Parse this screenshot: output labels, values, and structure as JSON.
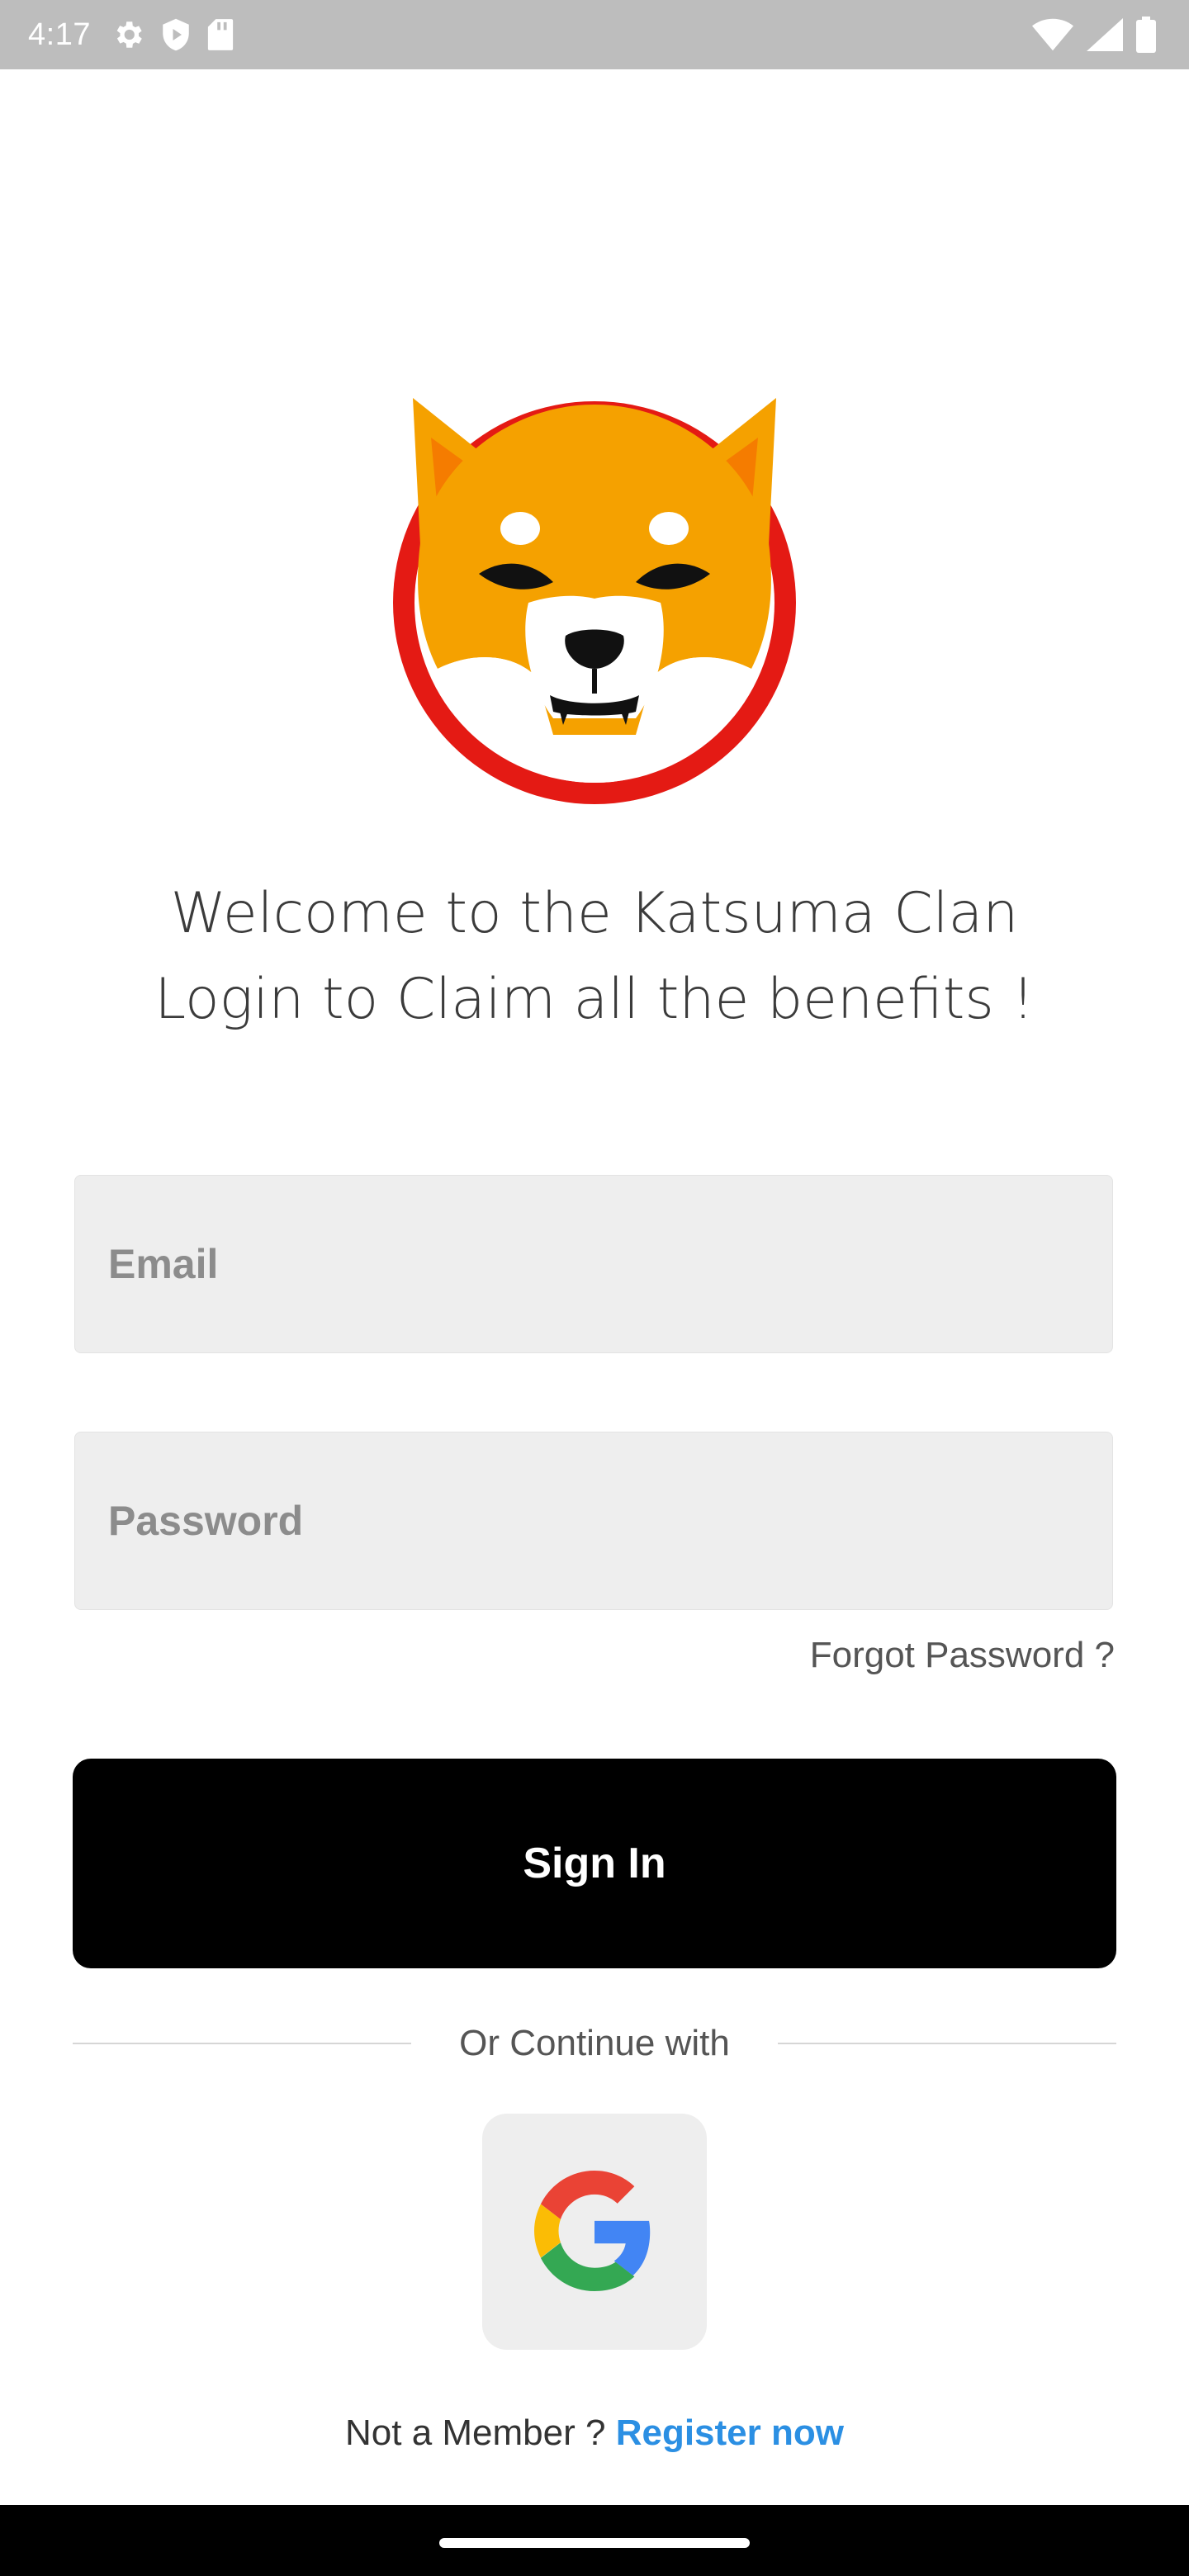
{
  "status_bar": {
    "time": "4:17",
    "icons": [
      "gear-icon",
      "shield-icon",
      "sd-card-icon",
      "wifi-icon",
      "signal-icon",
      "battery-icon"
    ]
  },
  "logo": {
    "name": "shiba-inu-logo",
    "colors": {
      "ring": "#e41a14",
      "fur": "#f5a100",
      "face": "#ffffff"
    }
  },
  "welcome": {
    "line1": "Welcome to the Katsuma Clan",
    "line2": "Login to Claim all the benefits !"
  },
  "form": {
    "email_placeholder": "Email",
    "password_placeholder": "Password",
    "forgot_password": "Forgot Password ?",
    "sign_in": "Sign In"
  },
  "divider": {
    "text": "Or Continue with"
  },
  "google": {
    "icon": "google-icon"
  },
  "register": {
    "prompt": "Not a Member ?",
    "link": "Register now",
    "link_color": "#2b8fe3"
  }
}
